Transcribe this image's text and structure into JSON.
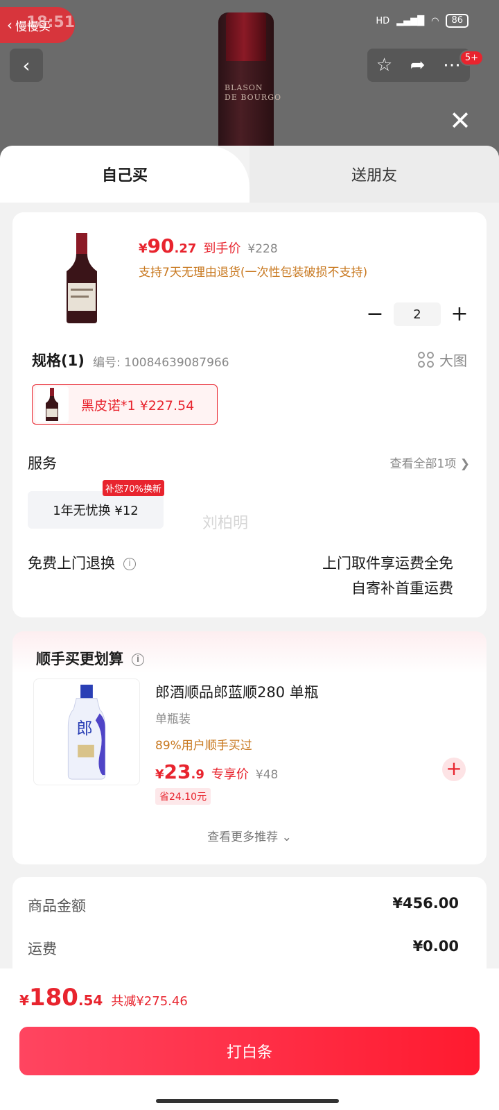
{
  "status": {
    "time": "18:51",
    "back_app": "慢慢买",
    "signal": "HD",
    "battery": "86"
  },
  "top_badge": "5+",
  "bottle_label": [
    "BLASON",
    "DE BOURGO"
  ],
  "tabs": [
    {
      "label": "自己买"
    },
    {
      "label": "送朋友"
    }
  ],
  "product": {
    "price_yen": "¥",
    "price_int": "90",
    "price_dec": ".27",
    "price_tag": "到手价",
    "orig_price": "¥228",
    "return_note": "支持7天无理由退货(一次性包装破损不支持)",
    "quantity": "2",
    "minus": "−",
    "plus": "+"
  },
  "spec": {
    "title": "规格(1)",
    "code": "编号: 10084639087966",
    "big_image": "大图",
    "chip_label": "黑皮诺*1  ¥227.54"
  },
  "service": {
    "title": "服务",
    "view_all": "查看全部1项  ❯",
    "item": "1年无忧换  ¥12",
    "promo": "补您70%换新"
  },
  "watermark": "刘柏明",
  "free_return": {
    "title": "免费上门退换",
    "line1": "上门取件享运费全免",
    "line2": "自寄补首重运费"
  },
  "recommend": {
    "title": "顺手买更划算",
    "name": "郎酒顺品郎蓝顺280 单瓶",
    "spec": "单瓶装",
    "pct": "89%用户顺手买过",
    "price_yen": "¥",
    "price_int": "23",
    "price_dec": ".9",
    "price_tag": "专享价",
    "orig_price": "¥48",
    "save": "省24.10元",
    "more": "查看更多推荐 ⌄"
  },
  "summary": {
    "goods_label": "商品金额",
    "goods_value": "¥456.00",
    "shipping_label": "运费",
    "shipping_value": "¥0.00"
  },
  "bottom": {
    "yen": "¥",
    "int": "180",
    "dec": ".54",
    "cut": "共减¥275.46",
    "pay_button": "打白条"
  },
  "colors": {
    "accent": "#e8242e",
    "orange": "#c8781f"
  }
}
